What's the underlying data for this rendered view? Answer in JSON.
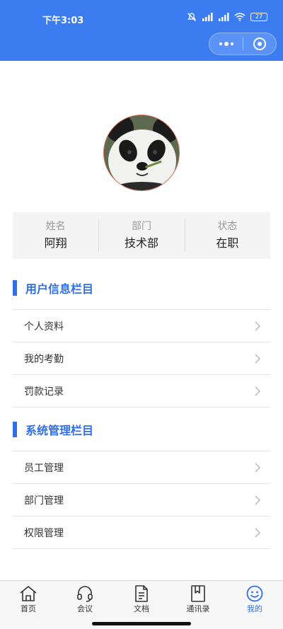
{
  "status_bar": {
    "time": "下午3:03",
    "battery": "27"
  },
  "profile": {
    "fields": [
      {
        "label": "姓名",
        "value": "阿翔"
      },
      {
        "label": "部门",
        "value": "技术部"
      },
      {
        "label": "状态",
        "value": "在职"
      }
    ]
  },
  "sections": [
    {
      "title": "用户信息栏目",
      "items": [
        {
          "label": "个人资料"
        },
        {
          "label": "我的考勤"
        },
        {
          "label": "罚款记录"
        }
      ]
    },
    {
      "title": "系统管理栏目",
      "items": [
        {
          "label": "员工管理"
        },
        {
          "label": "部门管理"
        },
        {
          "label": "权限管理"
        }
      ]
    }
  ],
  "tabbar": {
    "tabs": [
      {
        "label": "首页",
        "icon": "home-icon"
      },
      {
        "label": "会议",
        "icon": "headset-icon"
      },
      {
        "label": "文档",
        "icon": "document-icon"
      },
      {
        "label": "通讯录",
        "icon": "contacts-icon"
      },
      {
        "label": "我的",
        "icon": "smile-icon"
      }
    ],
    "active_index": 4
  },
  "colors": {
    "header": "#3b7cf0",
    "accent": "#2f6fe8",
    "card_bg": "#f4f4f5"
  }
}
